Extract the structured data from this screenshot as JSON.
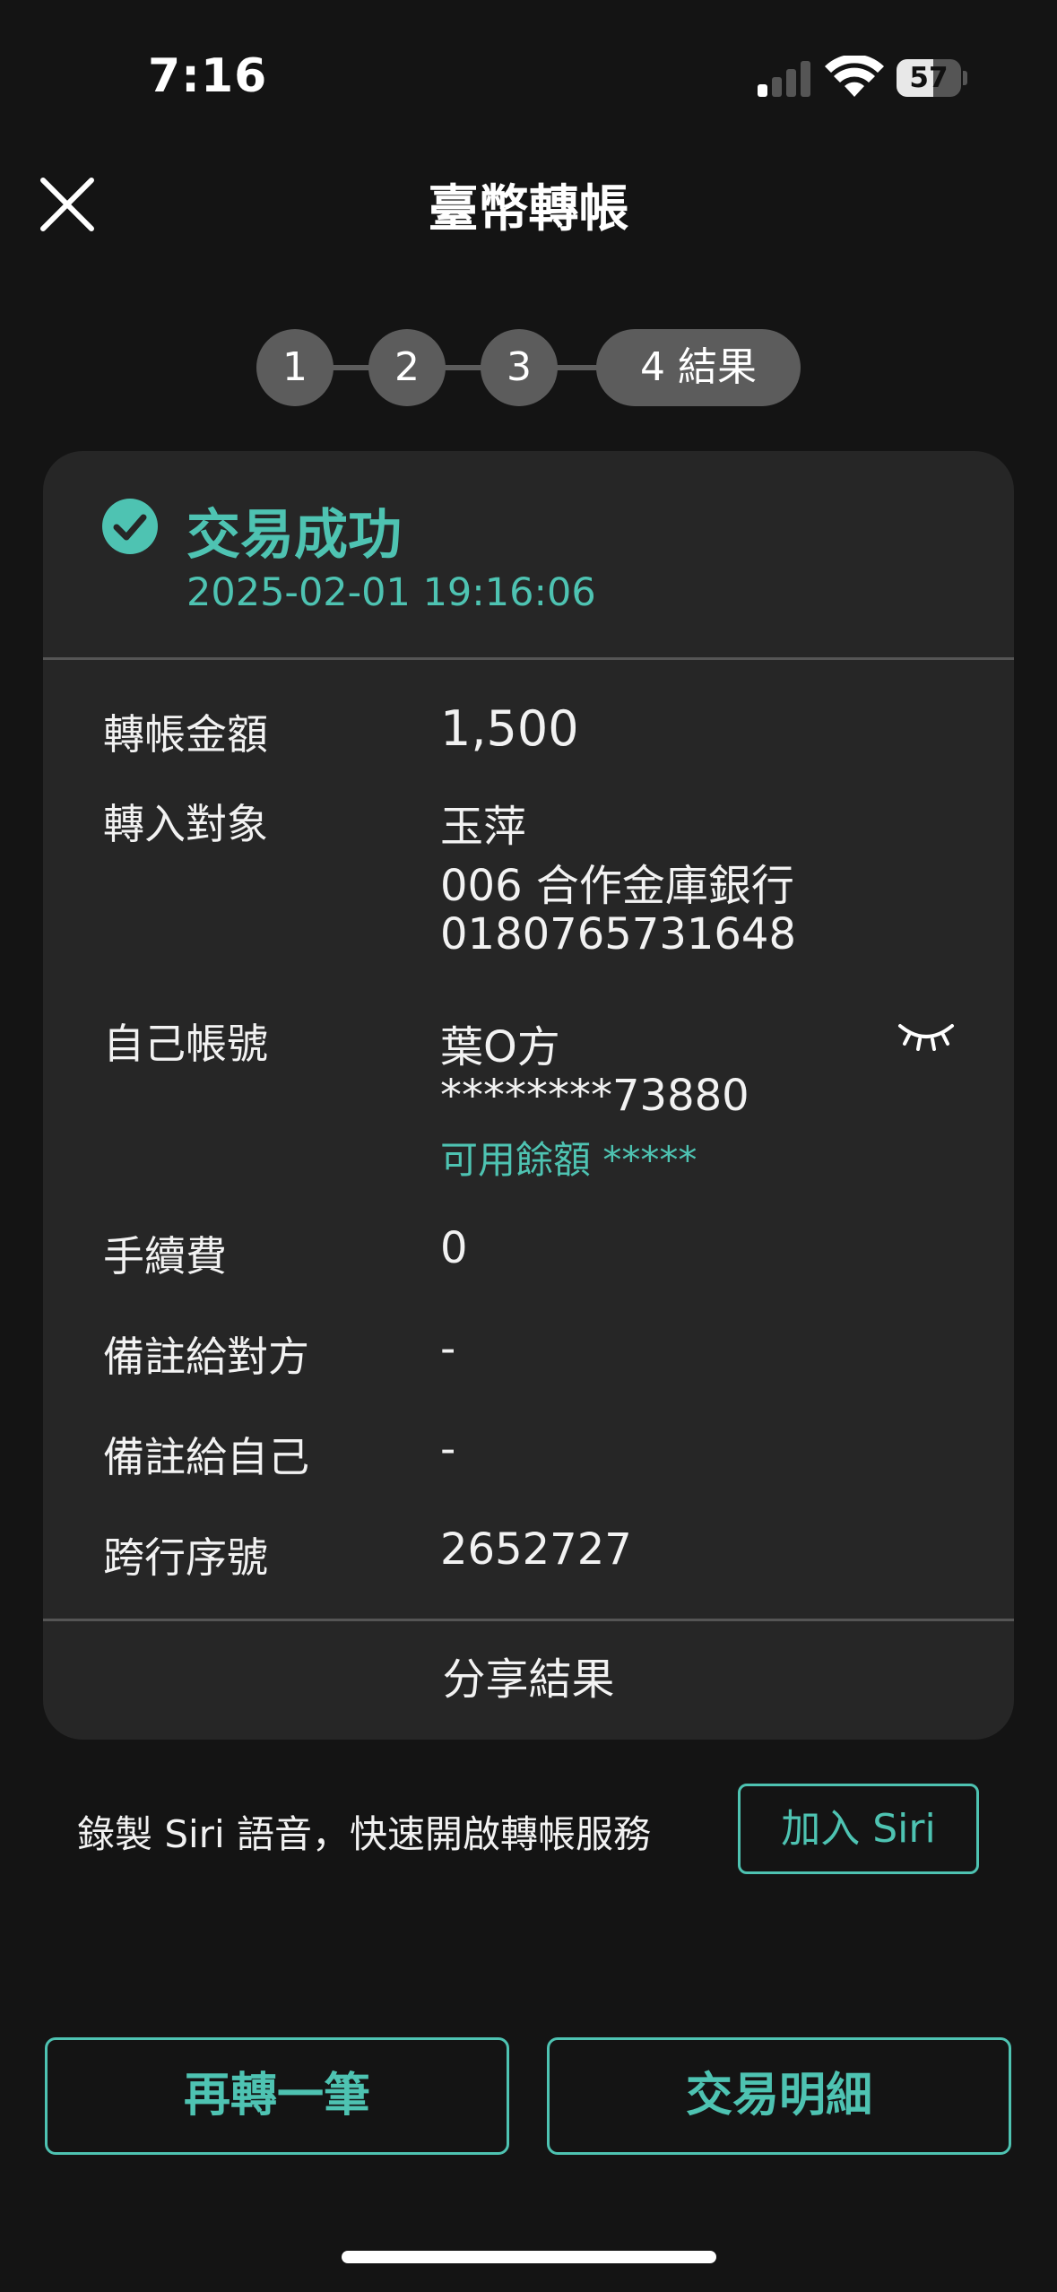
{
  "status_bar": {
    "time": "7:16",
    "battery": "57",
    "battery_level": 0.57
  },
  "header": {
    "title": "臺幣轉帳",
    "close_icon": "close-icon"
  },
  "stepper": {
    "steps": [
      "1",
      "2",
      "3",
      "4 結果"
    ],
    "current": 4
  },
  "result": {
    "status": "交易成功",
    "timestamp": "2025-02-01 19:16:06",
    "status_icon": "check-circle-icon",
    "rows": {
      "amount": {
        "label": "轉帳金額",
        "value": "1,500"
      },
      "payee": {
        "label": "轉入對象",
        "name": "玉萍",
        "bank": "006 合作金庫銀行",
        "account": "0180765731648"
      },
      "own_account": {
        "label": "自己帳號",
        "name": "葉O方",
        "account": "********73880",
        "balance": "可用餘額 *****",
        "toggle_icon": "eye-closed-icon"
      },
      "fee": {
        "label": "手續費",
        "value": "0"
      },
      "note_to_payee": {
        "label": "備註給對方",
        "value": "-"
      },
      "note_to_self": {
        "label": "備註給自己",
        "value": "-"
      },
      "interbank_seq": {
        "label": "跨行序號",
        "value": "2652727"
      }
    },
    "share_label": "分享結果"
  },
  "siri": {
    "text": "錄製 Siri 語音，快速開啟轉帳服務",
    "button": "加入 Siri"
  },
  "actions": {
    "again": "再轉一筆",
    "details": "交易明細"
  },
  "colors": {
    "accent": "#4ec3b2",
    "background": "#141414",
    "card": "#262626"
  }
}
